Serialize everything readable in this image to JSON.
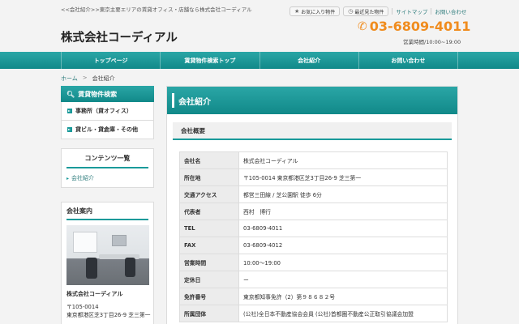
{
  "header": {
    "tagline": "<<会社紹介>>東京主要エリアの賃貸オフィス・店舗なら株式会社コーディアル",
    "favorites": "お気に入り物件",
    "recent": "最近見た物件",
    "sitemap": "サイトマップ",
    "contact": "お問い合わせ",
    "logo": "株式会社コーディアル",
    "phone": "03-6809-4011",
    "hours": "営業時間/10:00~19:00"
  },
  "nav": {
    "items": [
      {
        "label": "トップページ"
      },
      {
        "label": "賃貸物件検索トップ"
      },
      {
        "label": "会社紹介"
      },
      {
        "label": "お問い合わせ"
      }
    ]
  },
  "breadcrumb": {
    "home": "ホーム",
    "sep": ">",
    "current": "会社紹介"
  },
  "sidebar": {
    "search_title": "賃貸物件検索",
    "search_items": [
      {
        "label": "事務所（貸オフィス）"
      },
      {
        "label": "貸ビル・貸倉庫・その他"
      }
    ],
    "contents_title": "コンテンツ一覧",
    "contents_link": "会社紹介",
    "company_title": "会社案内",
    "company_name": "株式会社コーディアル",
    "postal": "〒105-0014",
    "address": "東京都港区芝3丁目26-9 芝三第一"
  },
  "main": {
    "title": "会社紹介",
    "subtitle": "会社概要",
    "rows": [
      {
        "key": "会社名",
        "value": "株式会社コーディアル"
      },
      {
        "key": "所在地",
        "value": "〒105-0014 東京都港区芝3丁目26-9 芝三第一"
      },
      {
        "key": "交通アクセス",
        "value": "都営三田線 / 芝公園駅 徒歩 6分"
      },
      {
        "key": "代表者",
        "value": "西村　博行"
      },
      {
        "key": "TEL",
        "value": "03-6809-4011"
      },
      {
        "key": "FAX",
        "value": "03-6809-4012"
      },
      {
        "key": "営業時間",
        "value": "10:00〜19:00"
      },
      {
        "key": "定休日",
        "value": "ー"
      },
      {
        "key": "免許番号",
        "value": "東京都知事免許（2）第９８６８２号"
      },
      {
        "key": "所属団体",
        "value": "(公社)全日本不動産協会会員 (公社)首都圏不動産公正取引協議会加盟"
      }
    ]
  },
  "icons": {
    "star": "star-icon",
    "clock": "clock-icon",
    "phone": "phone-icon",
    "search": "search-icon",
    "arrow": "arrow-icon"
  },
  "colors": {
    "teal": "#1a9a9a",
    "phone_orange": "#f08c1e"
  }
}
